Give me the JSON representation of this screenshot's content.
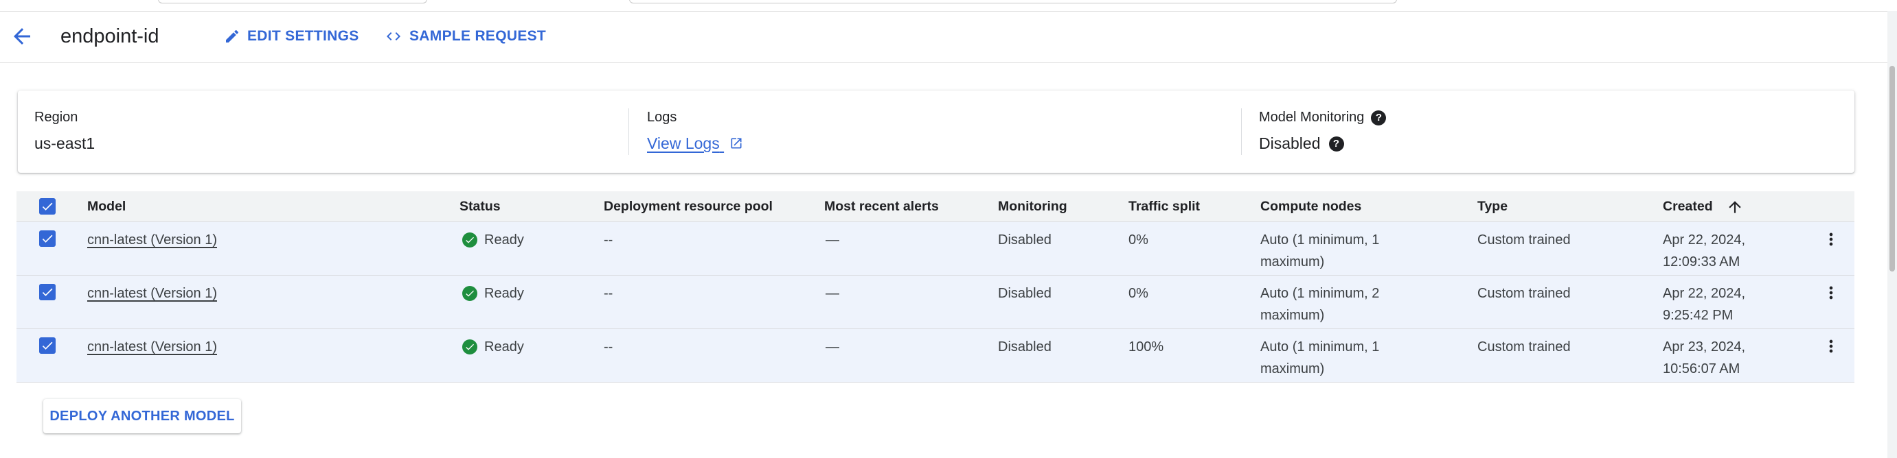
{
  "header": {
    "title": "endpoint-id",
    "edit_label": "EDIT SETTINGS",
    "sample_label": "SAMPLE REQUEST"
  },
  "summary": {
    "region_label": "Region",
    "region_value": "us-east1",
    "logs_label": "Logs",
    "logs_link": "View Logs",
    "monitoring_label": "Model Monitoring",
    "monitoring_value": "Disabled"
  },
  "table": {
    "columns": [
      "Model",
      "Status",
      "Deployment resource pool",
      "Most recent alerts",
      "Monitoring",
      "Traffic split",
      "Compute nodes",
      "Type",
      "Created"
    ],
    "rows": [
      {
        "model": "cnn-latest (Version 1)",
        "status": "Ready",
        "pool": "--",
        "alerts": "—",
        "monitoring": "Disabled",
        "traffic": "0%",
        "compute": "Auto (1 minimum, 1 maximum)",
        "type": "Custom trained",
        "created": "Apr 22, 2024, 12:09:33 AM"
      },
      {
        "model": "cnn-latest (Version 1)",
        "status": "Ready",
        "pool": "--",
        "alerts": "—",
        "monitoring": "Disabled",
        "traffic": "0%",
        "compute": "Auto (1 minimum, 2 maximum)",
        "type": "Custom trained",
        "created": "Apr 22, 2024, 9:25:42 PM"
      },
      {
        "model": "cnn-latest (Version 1)",
        "status": "Ready",
        "pool": "--",
        "alerts": "—",
        "monitoring": "Disabled",
        "traffic": "100%",
        "compute": "Auto (1 minimum, 1 maximum)",
        "type": "Custom trained",
        "created": "Apr 23, 2024, 10:56:07 AM"
      }
    ]
  },
  "deploy_label": "DEPLOY ANOTHER MODEL",
  "colors": {
    "accent": "#3367d6",
    "ready_green": "#1e8e3e",
    "row_selected_bg": "#eef3fc"
  },
  "icons": [
    "arrow-back-icon",
    "pencil-icon",
    "code-icon",
    "external-link-icon",
    "help-icon",
    "check-circle-icon",
    "more-vert-icon",
    "arrow-up-icon",
    "checkbox-checked-icon"
  ]
}
